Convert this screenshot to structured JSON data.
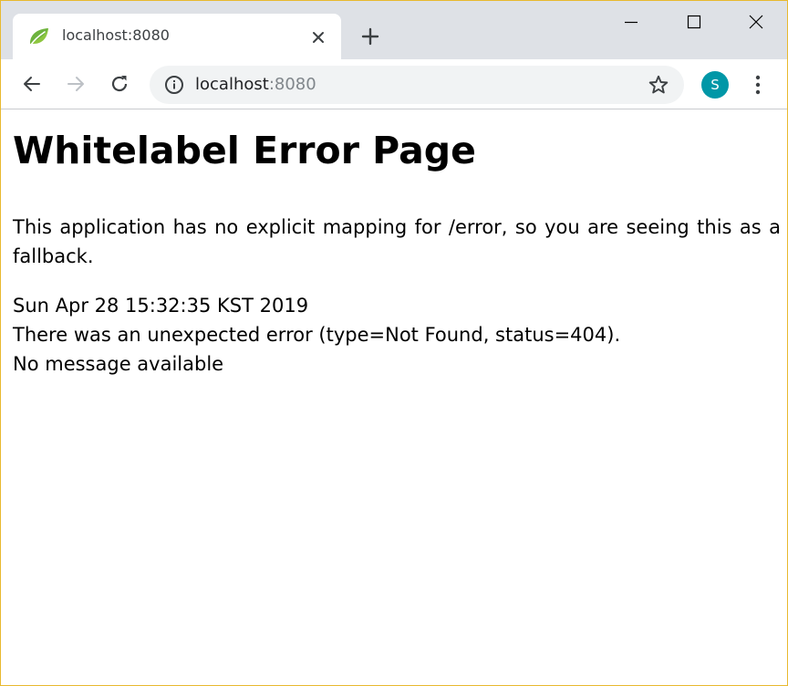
{
  "browser": {
    "tab": {
      "title": "localhost:8080",
      "favicon": "spring-leaf-icon"
    },
    "address_bar": {
      "host": "localhost",
      "port": ":8080"
    },
    "profile": {
      "initial": "S",
      "color": "#0197a7"
    },
    "colors": {
      "tabstrip": "#dee1e6",
      "omnibox": "#f1f3f4",
      "window_border": "#e8b92e"
    }
  },
  "page": {
    "heading": "Whitelabel Error Page",
    "message": "This application has no explicit mapping for /error, so you are seeing this as a fallback.",
    "timestamp": "Sun Apr 28 15:32:35 KST 2019",
    "error_line": "There was an unexpected error (type=Not Found, status=404).",
    "detail": "No message available"
  }
}
